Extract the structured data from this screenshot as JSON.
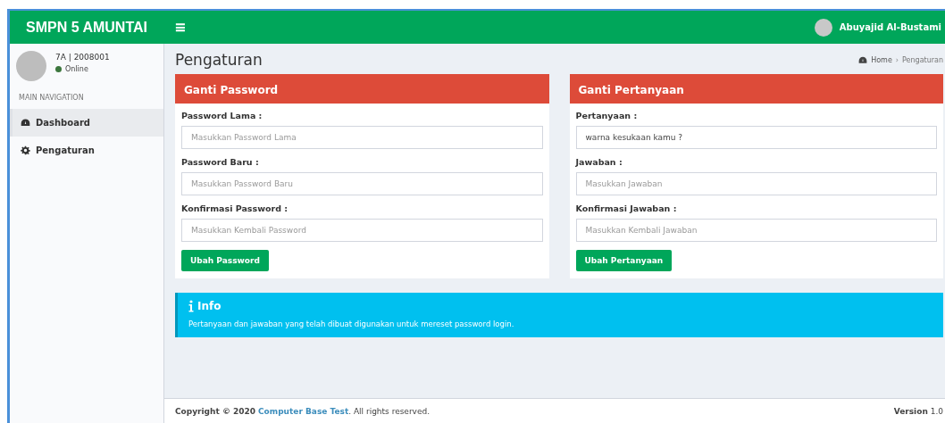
{
  "header": {
    "brand": "SMPN 5 AMUNTAI",
    "menu_toggle": "≡",
    "user_name": "Abuyajid Al-Bustami"
  },
  "sidebar": {
    "user": {
      "class_id": "7A | 2008001",
      "status": "Online"
    },
    "section_label": "MAIN NAVIGATION",
    "items": [
      {
        "label": "Dashboard",
        "selected": true
      },
      {
        "label": "Pengaturan",
        "selected": false
      }
    ]
  },
  "page": {
    "title": "Pengaturan",
    "breadcrumb": [
      "Home",
      "Pengaturan"
    ],
    "breadcrumb_separator": "›"
  },
  "cards": [
    {
      "title": "Ganti Password",
      "fields": [
        {
          "label": "Password Lama :",
          "placeholder": "Masukkan Password Lama"
        },
        {
          "label": "Password Baru :",
          "placeholder": "Masukkan Password Baru"
        },
        {
          "label": "Konfirmasi Password :",
          "placeholder": "Masukkan Kembali Password"
        }
      ],
      "button": "Ubah Password"
    },
    {
      "title": "Ganti Pertanyaan",
      "fields": [
        {
          "label": "Pertanyaan :",
          "value": "warna kesukaan kamu ?"
        },
        {
          "label": "Jawaban :",
          "placeholder": "Masukkan Jawaban"
        },
        {
          "label": "Konfirmasi Jawaban :",
          "placeholder": "Masukkan Kembali Jawaban"
        }
      ],
      "button": "Ubah Pertanyaan"
    }
  ],
  "info": {
    "title": "Info",
    "text": "Pertanyaan dan jawaban yang telah dibuat digunakan untuk mereset password login."
  },
  "footer": {
    "copyright_prefix": "Copyright © 2020",
    "link": "Computer Base Test",
    "copyright_suffix": ". All rights reserved.",
    "version": "**Version** 1.0"
  }
}
